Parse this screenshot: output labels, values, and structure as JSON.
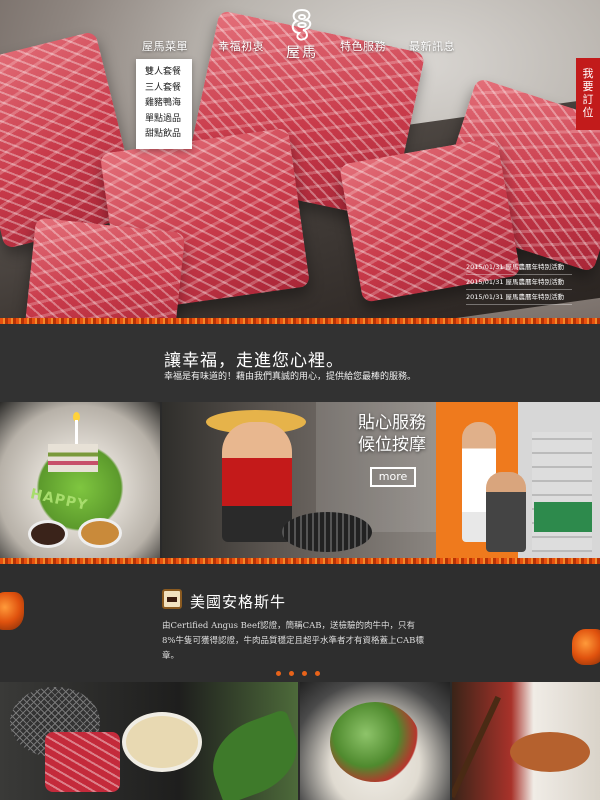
{
  "nav": {
    "menu": "屋馬菜單",
    "origin": "幸福初衷",
    "features": "特色服務",
    "news": "最新訊息",
    "logo_text": "屋馬"
  },
  "dropdown": [
    "雙人套餐",
    "三人套餐",
    "雞豬鴨海",
    "單點過品",
    "甜點飲品"
  ],
  "reserve": "我要訂位",
  "news_items": [
    "2015/01/31  屋馬農曆年特別活動",
    "2015/01/31  屋馬農曆年特別活動",
    "2015/01/31  屋馬農曆年特別活動"
  ],
  "intro": {
    "title": "讓幸福，走進您心裡。",
    "text": "幸福是有味道的！藉由我們真誠的用心，提供給您最棒的服務。"
  },
  "service": {
    "title_line1": "貼心服務",
    "title_line2": "候位按摩",
    "more": "more"
  },
  "cake_text": "HAPPY",
  "angus": {
    "title": "美國安格斯牛",
    "text": "由Certified Angus Beef認證，簡稱CAB，送檢驗的肉牛中，只有8%牛隻可獲得認證，牛肉品質穩定且超乎水準者才有資格蓋上CAB標章。"
  },
  "colors": {
    "accent_red": "#c21b1b",
    "ember_orange": "#e8631a",
    "panel_dark": "#323232"
  }
}
